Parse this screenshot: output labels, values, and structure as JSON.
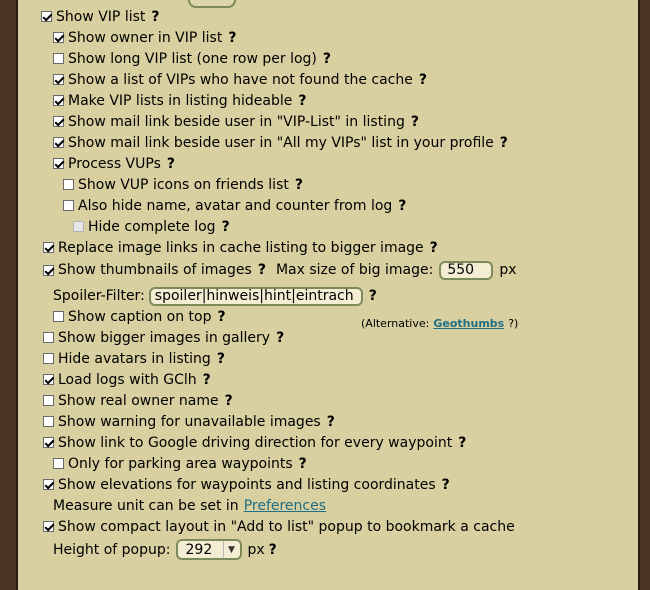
{
  "help_mark": "?",
  "items": {
    "show_vip_list": {
      "label": "Show VIP list",
      "checked": true
    },
    "show_owner_vip": {
      "label": "Show owner in VIP list",
      "checked": true
    },
    "show_long_vip": {
      "label": "Show long VIP list (one row per log)",
      "checked": false
    },
    "show_vips_not_found": {
      "label": "Show a list of VIPs who have not found the cache",
      "checked": true
    },
    "make_vip_hideable": {
      "label": "Make VIP lists in listing hideable",
      "checked": true
    },
    "mail_link_vip": {
      "label": "Show mail link beside user in \"VIP-List\" in listing",
      "checked": true
    },
    "mail_link_profile": {
      "label": "Show mail link beside user in \"All my VIPs\" list in your profile",
      "checked": true
    },
    "process_vups": {
      "label": "Process VUPs",
      "checked": true
    },
    "vup_icons": {
      "label": "Show VUP icons on friends list",
      "checked": false
    },
    "hide_name_avatar": {
      "label": "Also hide name, avatar and counter from log",
      "checked": false
    },
    "hide_complete_log": {
      "label": "Hide complete log",
      "checked": false,
      "disabled": true
    },
    "replace_image_links": {
      "label": "Replace image links in cache listing to bigger image",
      "checked": true
    },
    "show_thumbnails": {
      "label": "Show thumbnails of images",
      "checked": true
    },
    "show_caption": {
      "label": "Show caption on top",
      "checked": false
    },
    "bigger_gallery": {
      "label": "Show bigger images in gallery",
      "checked": false
    },
    "hide_avatars": {
      "label": "Hide avatars in listing",
      "checked": false
    },
    "load_logs": {
      "label": "Load logs with GClh",
      "checked": true
    },
    "real_owner": {
      "label": "Show real owner name",
      "checked": false
    },
    "warn_unavailable": {
      "label": "Show warning for unavailable images",
      "checked": false
    },
    "google_driving": {
      "label": "Show link to Google driving direction for every waypoint",
      "checked": true
    },
    "parking_only": {
      "label": "Only for parking area waypoints",
      "checked": false
    },
    "elevations": {
      "label": "Show elevations for waypoints and listing coordinates",
      "checked": true
    },
    "compact_layout": {
      "label": "Show compact layout in \"Add to list\" popup to bookmark a cache",
      "checked": true
    }
  },
  "thumbnails": {
    "max_size_label": "Max size of big image:",
    "max_size_value": "550",
    "unit": "px"
  },
  "spoiler": {
    "label": "Spoiler-Filter:",
    "value": "spoiler|hinweis|hint|eintrach"
  },
  "alternative": {
    "prefix": "(Alternative:",
    "link": "Geothumbs",
    "suffix": "?)"
  },
  "measure": {
    "text": "Measure unit can be set in",
    "link": "Preferences"
  },
  "popup": {
    "label": "Height of popup:",
    "value": "292",
    "unit": "px"
  }
}
